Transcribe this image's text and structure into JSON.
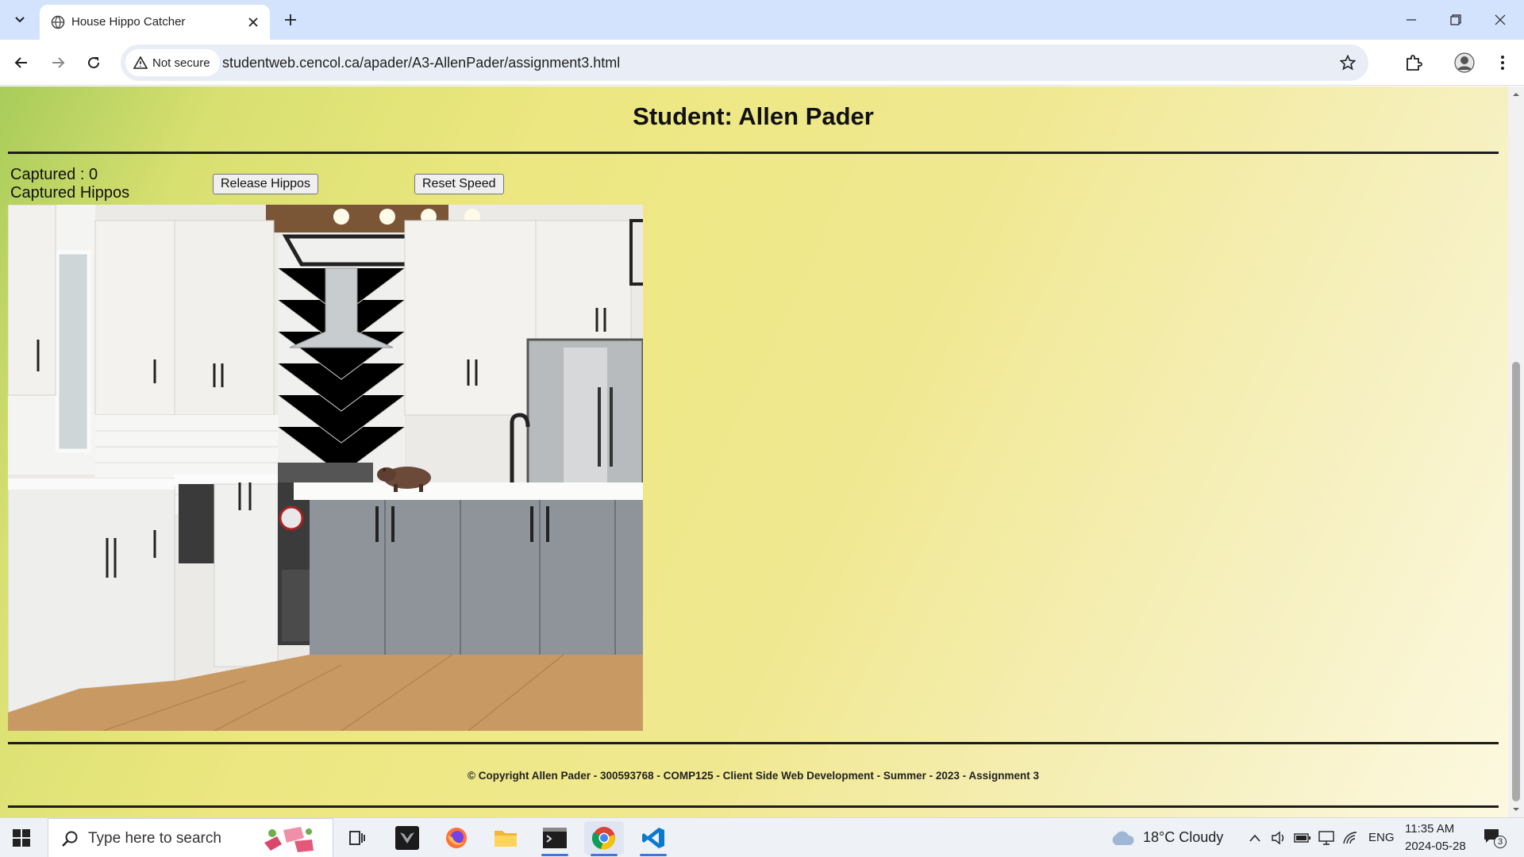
{
  "browser": {
    "tab_title": "House Hippo Catcher",
    "security_label": "Not secure",
    "url": "studentweb.cencol.ca/apader/A3-AllenPader/assignment3.html"
  },
  "page": {
    "heading": "Student: Allen Pader",
    "captured_count": "Captured : 0",
    "captured_label": "Captured Hippos",
    "release_button": "Release Hippos",
    "reset_button": "Reset Speed",
    "footer": "©  Copyright Allen Pader - 300593768 - COMP125 - Client Side Web Development - Summer - 2023 - Assignment 3"
  },
  "taskbar": {
    "search_placeholder": "Type here to search",
    "weather": "18°C  Cloudy",
    "language": "ENG",
    "time": "11:35 AM",
    "date": "2024-05-28",
    "notification_count": "3"
  },
  "colors": {
    "tabstrip": "#d3e3fd",
    "page_gradient_start": "#a8cc5a",
    "page_gradient_end": "#fdf9e2"
  }
}
